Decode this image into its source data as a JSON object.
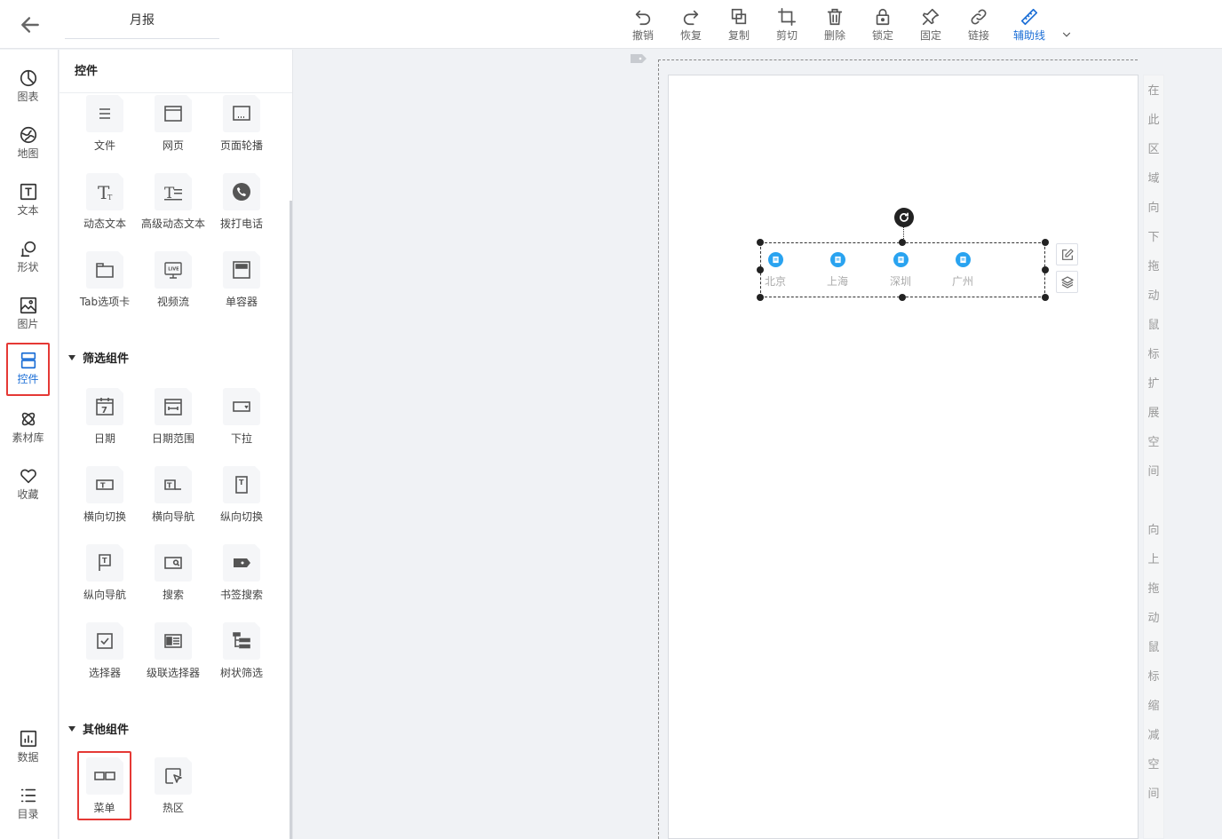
{
  "header": {
    "back_icon": "arrow-left-icon",
    "title": "月报"
  },
  "toolbar": {
    "items": [
      {
        "label": "撤销",
        "icon": "undo-icon"
      },
      {
        "label": "恢复",
        "icon": "redo-icon"
      },
      {
        "label": "复制",
        "icon": "copy-icon"
      },
      {
        "label": "剪切",
        "icon": "crop-icon"
      },
      {
        "label": "删除",
        "icon": "trash-icon"
      },
      {
        "label": "锁定",
        "icon": "lock-icon"
      },
      {
        "label": "固定",
        "icon": "pin-icon"
      },
      {
        "label": "链接",
        "icon": "link-icon"
      },
      {
        "label": "辅助线",
        "icon": "ruler-icon"
      }
    ],
    "active_color": "#1b6ed6"
  },
  "nav": {
    "items": [
      {
        "label": "图表",
        "icon": "chart-icon"
      },
      {
        "label": "地图",
        "icon": "map-icon"
      },
      {
        "label": "文本",
        "icon": "text-icon"
      },
      {
        "label": "形状",
        "icon": "shape-icon"
      },
      {
        "label": "图片",
        "icon": "image-icon"
      },
      {
        "label": "控件",
        "icon": "widget-icon"
      },
      {
        "label": "素材库",
        "icon": "material-icon"
      },
      {
        "label": "收藏",
        "icon": "heart-icon"
      },
      {
        "label": "数据",
        "icon": "data-icon"
      },
      {
        "label": "目录",
        "icon": "list-icon"
      }
    ],
    "active": "控件"
  },
  "panel": {
    "title": "控件",
    "basic": [
      {
        "label": "文件",
        "icon": "file-icon"
      },
      {
        "label": "网页",
        "icon": "webpage-icon"
      },
      {
        "label": "页面轮播",
        "icon": "carousel-icon"
      },
      {
        "label": "动态文本",
        "icon": "dynamic-text-icon"
      },
      {
        "label": "高级动态文本",
        "icon": "advanced-text-icon"
      },
      {
        "label": "拨打电话",
        "icon": "phone-icon"
      },
      {
        "label": "Tab选项卡",
        "icon": "tab-icon"
      },
      {
        "label": "视频流",
        "icon": "live-icon"
      },
      {
        "label": "单容器",
        "icon": "container-icon"
      }
    ],
    "filter_title": "筛选组件",
    "filter": [
      {
        "label": "日期",
        "icon": "calendar-icon"
      },
      {
        "label": "日期范围",
        "icon": "date-range-icon"
      },
      {
        "label": "下拉",
        "icon": "dropdown-icon"
      },
      {
        "label": "横向切换",
        "icon": "h-switch-icon"
      },
      {
        "label": "横向导航",
        "icon": "h-nav-icon"
      },
      {
        "label": "纵向切换",
        "icon": "v-switch-icon"
      },
      {
        "label": "纵向导航",
        "icon": "v-nav-icon"
      },
      {
        "label": "搜索",
        "icon": "search-icon"
      },
      {
        "label": "书签搜索",
        "icon": "bookmark-icon"
      },
      {
        "label": "选择器",
        "icon": "checkbox-icon"
      },
      {
        "label": "级联选择器",
        "icon": "cascade-icon"
      },
      {
        "label": "树状筛选",
        "icon": "tree-icon"
      }
    ],
    "other_title": "其他组件",
    "other": [
      {
        "label": "菜单",
        "icon": "menu-icon"
      },
      {
        "label": "热区",
        "icon": "hotspot-icon"
      }
    ]
  },
  "canvas": {
    "menu_entries": [
      "北京",
      "上海",
      "深圳",
      "广州"
    ],
    "side_hint_top": [
      "在",
      "此",
      "区",
      "域",
      "向",
      "下",
      "拖",
      "动",
      "鼠",
      "标",
      "扩",
      "展",
      "空",
      "间"
    ],
    "side_hint_bottom": [
      "向",
      "上",
      "拖",
      "动",
      "鼠",
      "标",
      "缩",
      "减",
      "空",
      "间"
    ]
  }
}
